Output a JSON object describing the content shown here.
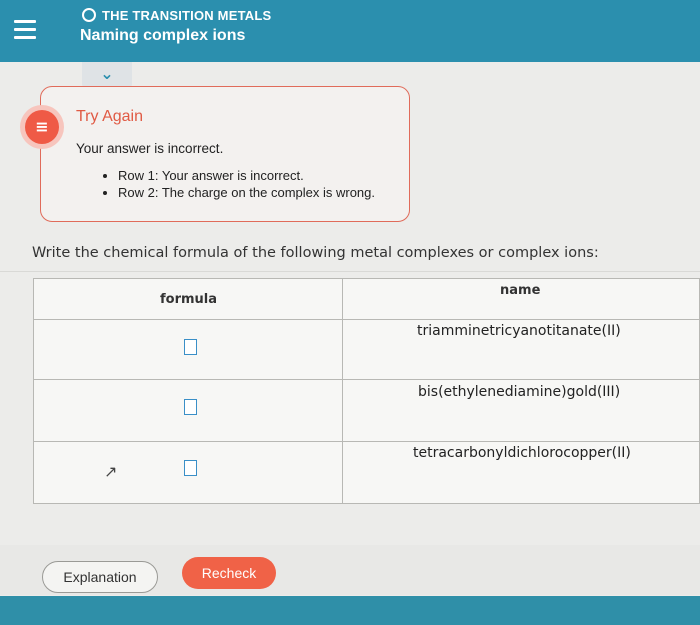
{
  "header": {
    "topic": "THE TRANSITION METALS",
    "title": "Naming complex ions"
  },
  "feedback": {
    "title": "Try Again",
    "message": "Your answer is incorrect.",
    "items": [
      "Row 1: Your answer is incorrect.",
      "Row 2: The charge on the complex is wrong."
    ]
  },
  "question": "Write the chemical formula of the following metal complexes or complex ions:",
  "table": {
    "headers": {
      "formula": "formula",
      "name": "name"
    },
    "rows": [
      {
        "name": "triamminetricyanotitanate(II)"
      },
      {
        "name": "bis(ethylenediamine)gold(III)"
      },
      {
        "name": "tetracarbonyldichlorocopper(II)"
      }
    ]
  },
  "buttons": {
    "explanation": "Explanation",
    "recheck": "Recheck"
  },
  "colors": {
    "header": "#2b8fae",
    "error": "#ef5a46",
    "recheck": "#f06247"
  },
  "icons": [
    "menu-icon",
    "circle-icon",
    "chevron-down-icon",
    "feedback-icon",
    "cursor-icon"
  ]
}
